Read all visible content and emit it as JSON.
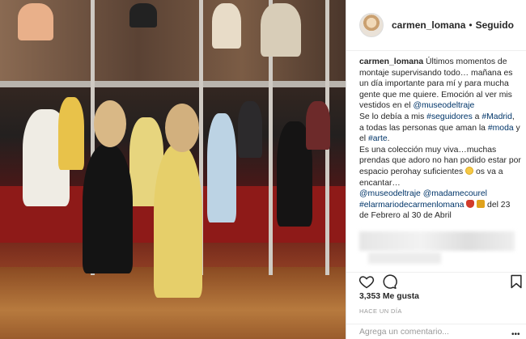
{
  "post": {
    "image_alt": "",
    "header": {
      "username": "carmen_lomana",
      "separator": "•",
      "follow_status": "Seguido"
    },
    "caption": {
      "username": "carmen_lomana",
      "line1": " Últimos momentos de montaje supervisando todo… mañana es un día importante para mí y para mucha gente que me quiere. Emoción al ver mis vestidos en el ",
      "tag_museo": "@museodeltraje",
      "line2": "Se lo debía a mis ",
      "tag_seguidores": "#seguidores",
      "line2b": " a ",
      "tag_madrid": "#Madrid",
      "line2c": ", a todas las personas que aman la ",
      "tag_moda": "#moda",
      "line2d": " y el ",
      "tag_arte": "#arte",
      "line2e": ".",
      "line3": "Es una colección muy viva…muchas prendas que adoro no han podido estar por espacio perohay suficientes ",
      "line3b": " os va a encantar…",
      "tag_museo2": "@museodeltraje",
      "tag_madame": "@madamecourel",
      "tag_armario": "#elarmariodecarmenlomana",
      "line4": " del 23 de Febrero al 30 de Abril"
    },
    "stats": {
      "likes_count": "3,353",
      "likes_label": "Me gusta"
    },
    "time_label": "HACE UN DÍA",
    "comment": {
      "placeholder": "Agrega un comentario...",
      "more_label": "•••"
    },
    "icons": {
      "like": "heart-icon",
      "comment": "comment-bubble-icon",
      "save": "bookmark-icon",
      "avatar": "profile-avatar"
    }
  }
}
